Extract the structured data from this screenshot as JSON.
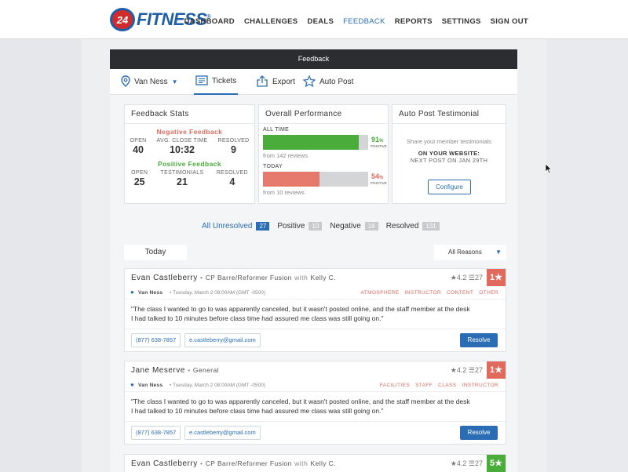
{
  "brand": {
    "badge": "24",
    "name": "FITNESS",
    "mark": "®"
  },
  "nav": [
    "DASHBOARD",
    "CHALLENGES",
    "DEALS",
    "FEEDBACK",
    "REPORTS",
    "SETTINGS",
    "SIGN OUT"
  ],
  "nav_active": "FEEDBACK",
  "panel": {
    "title": "Feedback"
  },
  "toolbar": {
    "location": "Van Ness",
    "tickets": "Tickets",
    "export": "Export",
    "autopost": "Auto Post"
  },
  "stats": {
    "title": "Feedback Stats",
    "negative_label": "Negative Feedback",
    "negative": [
      {
        "label": "OPEN",
        "value": "40"
      },
      {
        "label": "AVG. CLOSE TIME",
        "value": "10:32"
      },
      {
        "label": "RESOLVED",
        "value": "9"
      }
    ],
    "positive_label": "Positive Feedback",
    "positive": [
      {
        "label": "OPEN",
        "value": "25"
      },
      {
        "label": "TESTIMONIALS",
        "value": "21"
      },
      {
        "label": "RESOLVED",
        "value": "4"
      }
    ]
  },
  "performance": {
    "title": "Overall Performance",
    "all_time": {
      "label": "ALL TIME",
      "percent": 91,
      "percent_text": "91",
      "unit": "%",
      "tag": "POSITIVE",
      "reviews": "from 142 reviews"
    },
    "today": {
      "label": "TODAY",
      "percent": 54,
      "percent_text": "54",
      "unit": "%",
      "tag": "POSITIVE",
      "reviews": "from 10 reviews"
    }
  },
  "autopost": {
    "title": "Auto Post Testimonial",
    "text": "Share your member testimonials",
    "website": "ON YOUR WEBSITE:",
    "next": "NEXT POST ON JAN 29TH",
    "button": "Configure"
  },
  "filters": [
    {
      "label": "All Unresolved",
      "count": "27",
      "active": true
    },
    {
      "label": "Positive",
      "count": "10",
      "active": false
    },
    {
      "label": "Negative",
      "count": "18",
      "active": false
    },
    {
      "label": "Resolved",
      "count": "131",
      "active": false
    }
  ],
  "date_group": "Today",
  "reason_select": "All Reasons",
  "tickets": [
    {
      "name": "Evan Castleberry",
      "sep": "•",
      "class": "CP Barre/Reformer Fusion",
      "with": "with",
      "instructor": "Kelly C.",
      "rating": "★4.2",
      "count": "☰27",
      "badge": "1★",
      "badge_type": "neg",
      "city": "Van Ness",
      "date": "•   Tuesday, March 2   08:00AM (GMT -0500)",
      "tags": [
        "ATMOSPHERE",
        "INSTRUCTOR",
        "CONTENT",
        "OTHER"
      ],
      "body_1": "\"The class I wanted to go to was apparently canceled, but it wasn't posted online, and the staff member at the desk",
      "body_2": "I had talked to 10 minutes before class time had assured me class was still going on.\"",
      "phone": "(877) 638-7857",
      "email": "e.castleberry@gmail.com",
      "action": "Resolve"
    },
    {
      "name": "Jane Meserve",
      "sep": "•",
      "class": "General",
      "with": "",
      "instructor": "",
      "rating": "★4.2",
      "count": "☰27",
      "badge": "1★",
      "badge_type": "neg",
      "city": "Van Ness",
      "date": "•   Tuesday, March 2   08:00AM (GMT -0500)",
      "tags": [
        "FACILITIES",
        "STAFF",
        "CLASS",
        "INSTRUCTOR"
      ],
      "body_1": "\"The class I wanted to go to was apparently canceled, but it wasn't posted online, and the staff member at the desk",
      "body_2": "I had talked to 10 minutes before class time had assured me class was still going on.\"",
      "phone": "(877) 638-7857",
      "email": "e.castleberry@gmail.com",
      "action": "Resolve"
    },
    {
      "name": "Evan Castleberry",
      "sep": "•",
      "class": "CP Barre/Reformer Fusion",
      "with": "with",
      "instructor": "Kelly C.",
      "rating": "★4.2",
      "count": "☰27",
      "badge": "5★",
      "badge_type": "pos"
    }
  ],
  "colors": {
    "accent": "#2a6db5",
    "negative": "#e16a5e",
    "positive": "#4aac3a",
    "header": "#2b2d31"
  }
}
